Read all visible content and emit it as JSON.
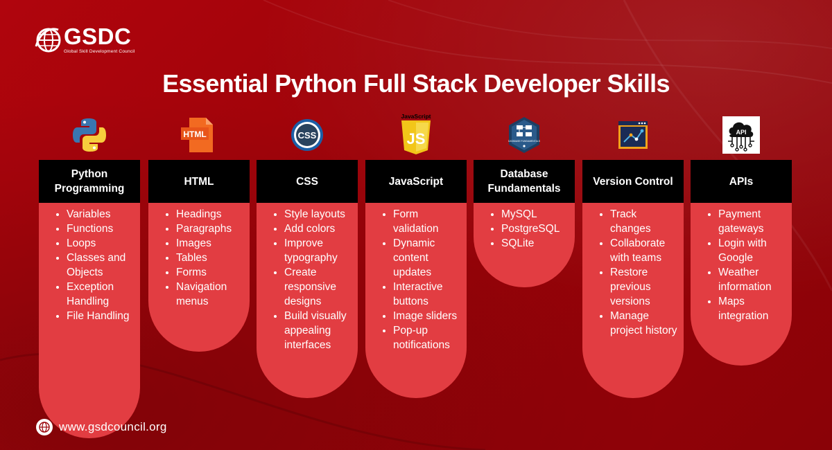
{
  "brand": {
    "name": "GSDC",
    "tagline": "Global Skill Development Council"
  },
  "title": "Essential Python Full Stack Developer Skills",
  "columns": [
    {
      "id": "python",
      "icon": "python-logo-icon",
      "heading": "Python Programming",
      "items": [
        "Variables",
        "Functions",
        "Loops",
        "Classes and Objects",
        "Exception Handling",
        "File Handling"
      ]
    },
    {
      "id": "html",
      "icon": "html-file-icon",
      "icon_label": "HTML",
      "heading": "HTML",
      "items": [
        "Headings",
        "Paragraphs",
        "Images",
        "Tables",
        "Forms",
        "Navigation menus"
      ]
    },
    {
      "id": "css",
      "icon": "css-badge-icon",
      "icon_label": "CSS",
      "heading": "CSS",
      "items": [
        "Style layouts",
        "Add colors",
        "Improve typography",
        "Create responsive designs",
        "Build visually appealing interfaces"
      ]
    },
    {
      "id": "javascript",
      "icon": "javascript-shield-icon",
      "icon_label": "JavaScript",
      "heading": "JavaScript",
      "items": [
        "Form validation",
        "Dynamic content updates",
        "Interactive buttons",
        "Image sliders",
        "Pop-up notifications"
      ]
    },
    {
      "id": "database",
      "icon": "database-badge-icon",
      "icon_label": "DATABASE FUNDAMENTALS",
      "heading": "Database Fundamentals",
      "items": [
        "MySQL",
        "PostgreSQL",
        "SQLite"
      ]
    },
    {
      "id": "version",
      "icon": "version-control-window-icon",
      "heading": "Version Control",
      "items": [
        "Track changes",
        "Collaborate with teams",
        "Restore previous versions",
        "Manage project history"
      ]
    },
    {
      "id": "apis",
      "icon": "api-cloud-icon",
      "icon_label": "API",
      "heading": "APIs",
      "items": [
        "Payment gateways",
        "Login with Google",
        "Weather information",
        "Maps integration"
      ]
    }
  ],
  "footer": {
    "website": "www.gsdcouncil.org",
    "icon": "globe-icon"
  },
  "colors": {
    "background": "#9a0208",
    "card_header": "#000000",
    "card_body": "#e23d42",
    "text": "#ffffff"
  }
}
